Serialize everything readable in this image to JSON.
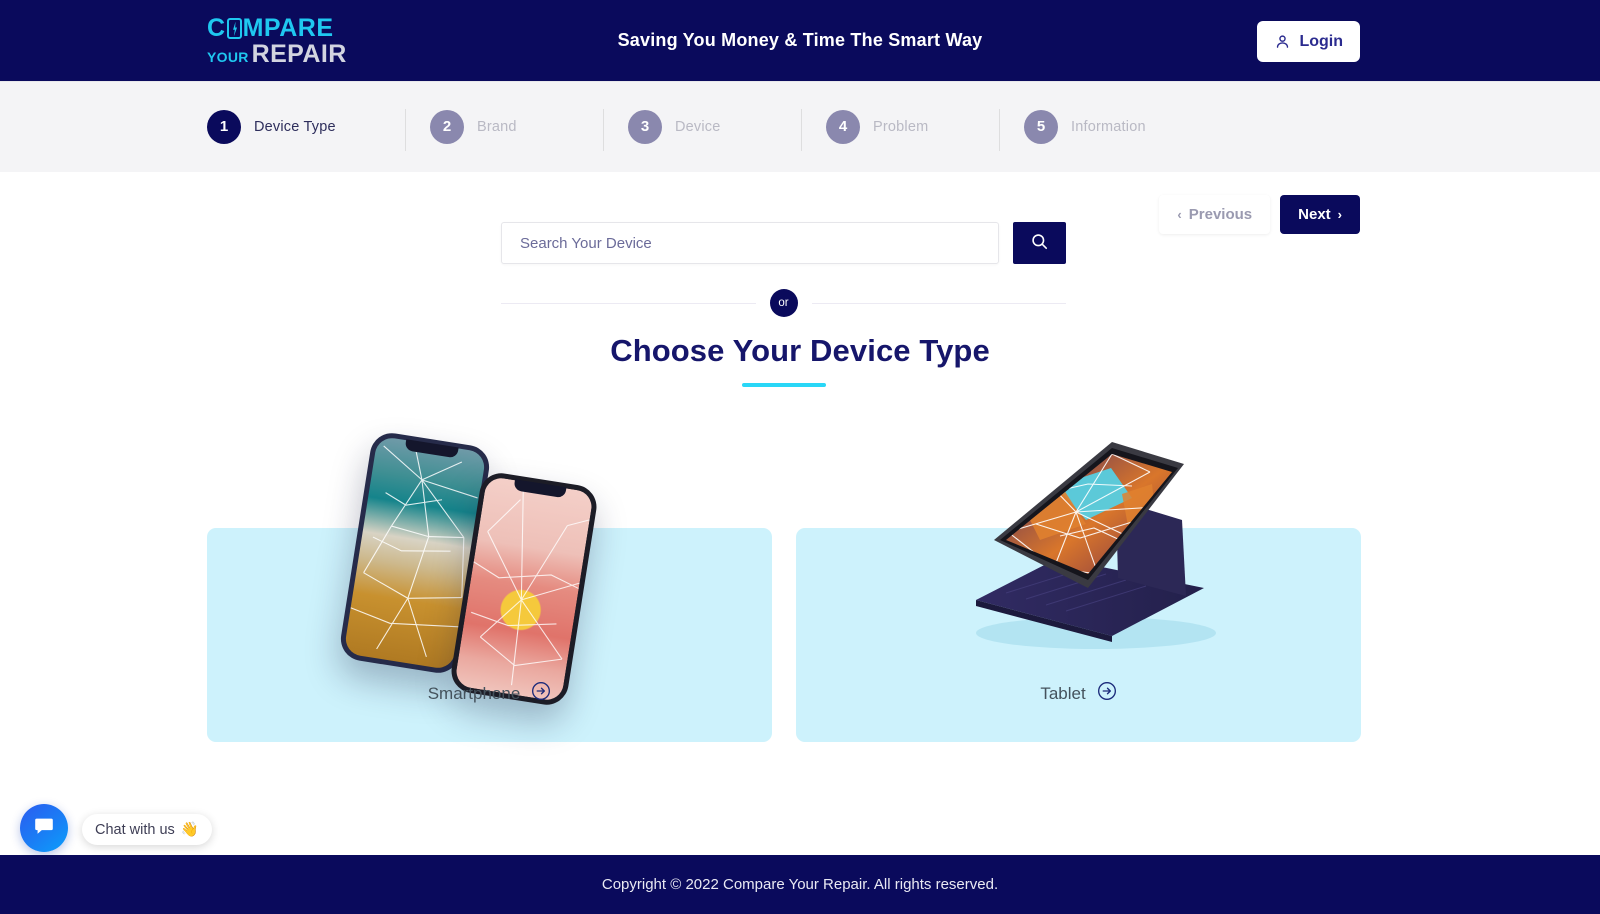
{
  "header": {
    "logo": {
      "part1": "C",
      "part2": "MPARE",
      "your": "YOUR",
      "repair": "REPAIR"
    },
    "tagline": "Saving You Money & Time The Smart Way",
    "login_label": "Login",
    "bg_color": "#0a0a5c",
    "accent_color": "#1fc8f0"
  },
  "stepper": {
    "steps": [
      {
        "number": "1",
        "label": "Device Type",
        "active": true
      },
      {
        "number": "2",
        "label": "Brand",
        "active": false
      },
      {
        "number": "3",
        "label": "Device",
        "active": false
      },
      {
        "number": "4",
        "label": "Problem",
        "active": false
      },
      {
        "number": "5",
        "label": "Information",
        "active": false
      }
    ],
    "previous_label": "Previous",
    "next_label": "Next",
    "prev_chevron": "‹",
    "next_chevron": "›"
  },
  "search": {
    "placeholder": "Search Your Device",
    "value": "",
    "button_icon": "search-icon"
  },
  "divider": {
    "text": "or"
  },
  "main": {
    "heading": "Choose Your Device Type",
    "underline_color": "#29d7f7",
    "cards": [
      {
        "label": "Smartphone",
        "icon": "arrow-right-circle-icon",
        "bg_color": "#cdf2fc"
      },
      {
        "label": "Tablet",
        "icon": "arrow-right-circle-icon",
        "bg_color": "#cdf2fc"
      }
    ]
  },
  "chat": {
    "label": "Chat with us",
    "emoji": "👋",
    "button_icon": "chat-bubble-icon"
  },
  "footer": {
    "copyright": "Copyright © 2022 Compare Your Repair. All rights reserved."
  }
}
